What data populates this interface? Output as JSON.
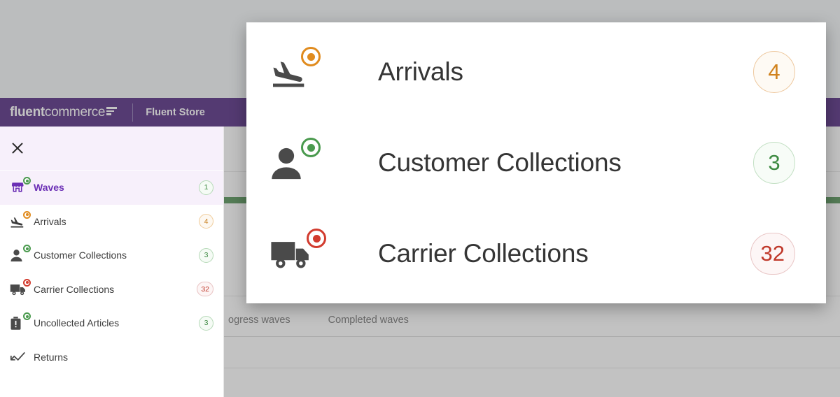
{
  "appbar": {
    "logo_bold": "fluent",
    "logo_light": "commerce",
    "logo_mark": "fluent-logo-mark",
    "store_name": "Fluent Store",
    "brand_color": "#38086e"
  },
  "sidebar": {
    "close_label": "close-drawer",
    "items": [
      {
        "label": "Waves",
        "badge": "1",
        "badge_tone": "green",
        "status_tone": "green",
        "icon": "store-icon",
        "active": true,
        "has_badge": true,
        "has_status": true
      },
      {
        "label": "Arrivals",
        "badge": "4",
        "badge_tone": "orange",
        "status_tone": "orange",
        "icon": "plane-landing-icon",
        "active": false,
        "has_badge": true,
        "has_status": true
      },
      {
        "label": "Customer Collections",
        "badge": "3",
        "badge_tone": "green",
        "status_tone": "green",
        "icon": "person-icon",
        "active": false,
        "has_badge": true,
        "has_status": true
      },
      {
        "label": "Carrier Collections",
        "badge": "32",
        "badge_tone": "red",
        "status_tone": "red",
        "icon": "truck-icon",
        "active": false,
        "has_badge": true,
        "has_status": true
      },
      {
        "label": "Uncollected Articles",
        "badge": "3",
        "badge_tone": "green",
        "status_tone": "green",
        "icon": "parcel-alert-icon",
        "active": false,
        "has_badge": true,
        "has_status": true
      },
      {
        "label": "Returns",
        "badge": "",
        "badge_tone": "green",
        "status_tone": "green",
        "icon": "return-arrow-icon",
        "active": false,
        "has_badge": false,
        "has_status": false
      }
    ]
  },
  "modal": {
    "rows": [
      {
        "label": "Arrivals",
        "count": "4",
        "tone": "orange",
        "icon": "plane-landing-icon"
      },
      {
        "label": "Customer Collections",
        "count": "3",
        "tone": "green",
        "icon": "person-icon"
      },
      {
        "label": "Carrier Collections",
        "count": "32",
        "tone": "red",
        "icon": "truck-icon"
      }
    ]
  },
  "content": {
    "tabs": [
      {
        "label": "ogress waves"
      },
      {
        "label": "Completed waves"
      }
    ]
  }
}
